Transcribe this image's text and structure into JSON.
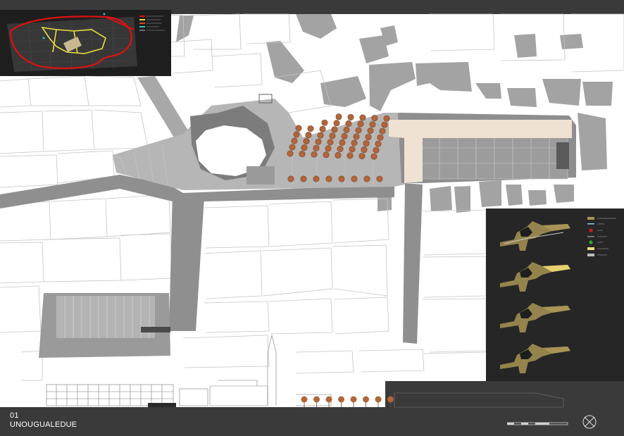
{
  "project": {
    "number": "01",
    "name": "UNOUGUALEDUE"
  },
  "colors": {
    "background": "#3a3a3a",
    "paper": "#ffffff",
    "building_outline": "#c8c8c8",
    "shadow": "#9e9e9e",
    "street": "#8e8e8e",
    "paving": "#b4b4b4",
    "tree": "#b0663a",
    "canopy": "#f0e4d6",
    "route_red": "#e01010",
    "route_yellow": "#e8e040",
    "phase_gold": "#a89454",
    "legend_red": "#d81818",
    "legend_green": "#2fa82f"
  },
  "icons": {
    "north_arrow": "compass-north-icon",
    "scale": "scale-bar-icon"
  }
}
